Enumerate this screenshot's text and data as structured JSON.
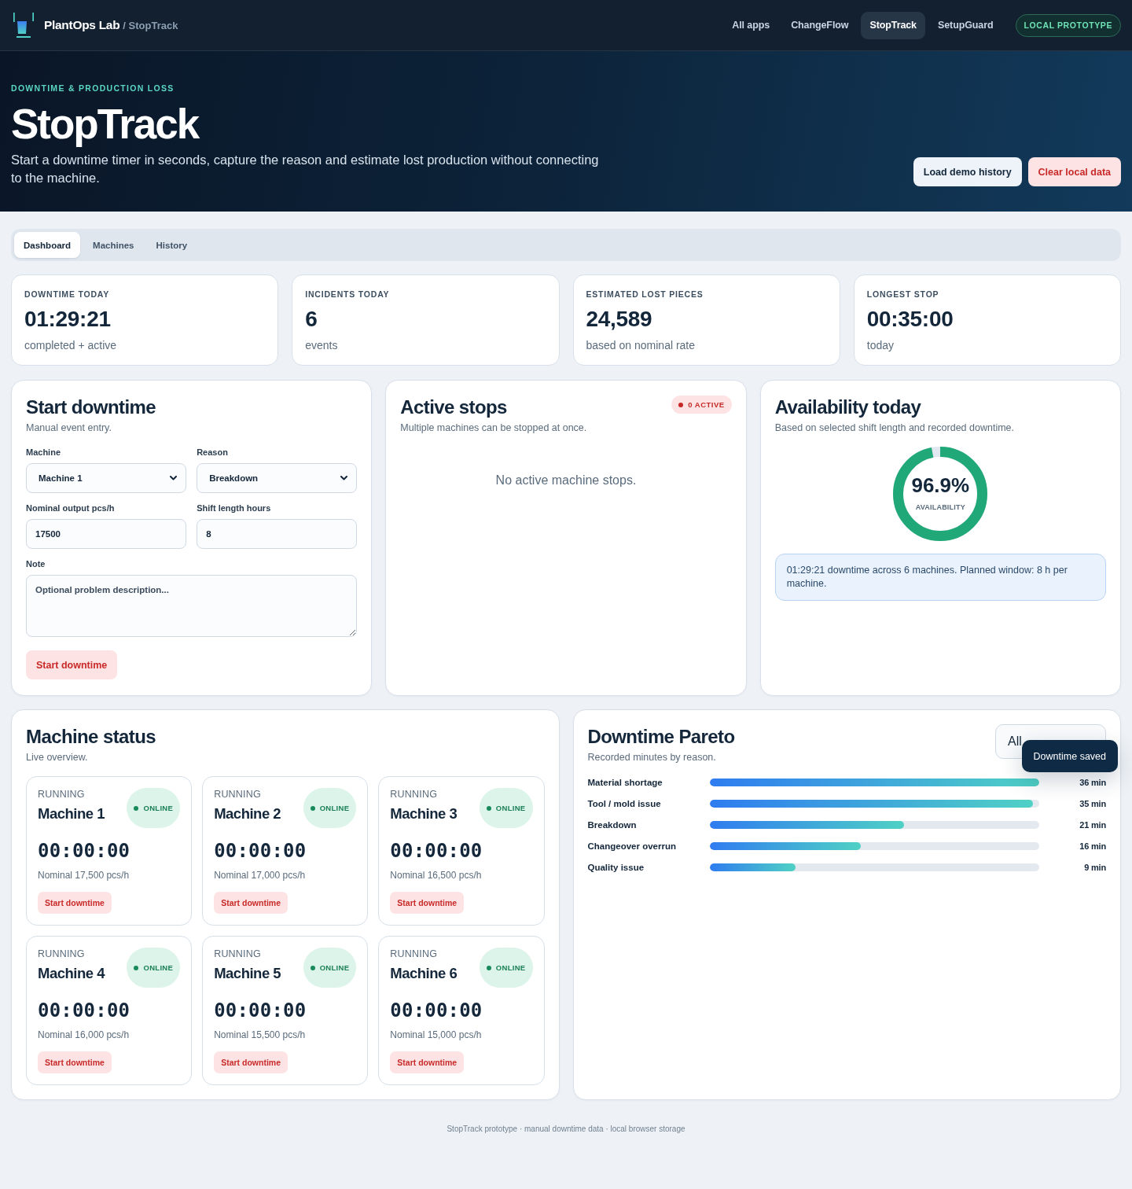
{
  "nav": {
    "brand": "PlantOps Lab",
    "product": "/ StopTrack",
    "links": [
      {
        "label": "All apps",
        "selected": false
      },
      {
        "label": "ChangeFlow",
        "selected": false
      },
      {
        "label": "StopTrack",
        "selected": true
      },
      {
        "label": "SetupGuard",
        "selected": false
      }
    ],
    "badge": "LOCAL PROTOTYPE"
  },
  "hero": {
    "eyebrow": "DOWNTIME & PRODUCTION LOSS",
    "title": "StopTrack",
    "description": "Start a downtime timer in seconds, capture the reason and estimate lost production without connecting to the machine.",
    "buttons": [
      {
        "label": "Load demo history",
        "kind": "secondary"
      },
      {
        "label": "Clear local data",
        "kind": "danger"
      }
    ]
  },
  "tabs": [
    {
      "label": "Dashboard",
      "selected": true
    },
    {
      "label": "Machines",
      "selected": false
    },
    {
      "label": "History",
      "selected": false
    }
  ],
  "stats": [
    {
      "label": "DOWNTIME TODAY",
      "value": "01:29:21",
      "caption": "completed + active"
    },
    {
      "label": "INCIDENTS TODAY",
      "value": "6",
      "caption": "events"
    },
    {
      "label": "ESTIMATED LOST PIECES",
      "value": "24,589",
      "caption": "based on nominal rate"
    },
    {
      "label": "LONGEST STOP",
      "value": "00:35:00",
      "caption": "today"
    }
  ],
  "start_form": {
    "title": "Start downtime",
    "subtitle": "Manual event entry.",
    "fields": [
      {
        "kind": "select",
        "label": "Machine",
        "value": "Machine 1"
      },
      {
        "kind": "select",
        "label": "Reason",
        "value": "Breakdown"
      },
      {
        "kind": "input",
        "label": "Nominal output pcs/h",
        "value": "17500"
      },
      {
        "kind": "input",
        "label": "Shift length hours",
        "value": "8"
      },
      {
        "kind": "textarea",
        "label": "Note",
        "placeholder": "Optional problem description..."
      }
    ],
    "button": "Start downtime"
  },
  "active_stops": {
    "title": "Active stops",
    "subtitle": "Multiple machines can be stopped at once.",
    "badge": "0 ACTIVE",
    "empty_message": "No active machine stops."
  },
  "availability": {
    "title": "Availability today",
    "subtitle": "Based on selected shift length and recorded downtime.",
    "level": 0.969,
    "reading": "96.9%",
    "caption": "AVAILABILITY",
    "note": "01:29:21 downtime across 6 machines. Planned window: 8 h per machine."
  },
  "machine_status": {
    "title": "Machine status",
    "subtitle": "Live overview.",
    "machines": [
      {
        "state": "RUNNING",
        "name": "Machine 1",
        "online": true,
        "status": "ONLINE",
        "timer": "00:00:00",
        "nominal": "Nominal 17,500 pcs/h",
        "button": "Start downtime"
      },
      {
        "state": "RUNNING",
        "name": "Machine 2",
        "online": true,
        "status": "ONLINE",
        "timer": "00:00:00",
        "nominal": "Nominal 17,000 pcs/h",
        "button": "Start downtime"
      },
      {
        "state": "RUNNING",
        "name": "Machine 3",
        "online": true,
        "status": "ONLINE",
        "timer": "00:00:00",
        "nominal": "Nominal 16,500 pcs/h",
        "button": "Start downtime"
      },
      {
        "state": "RUNNING",
        "name": "Machine 4",
        "online": true,
        "status": "ONLINE",
        "timer": "00:00:00",
        "nominal": "Nominal 16,000 pcs/h",
        "button": "Start downtime"
      },
      {
        "state": "RUNNING",
        "name": "Machine 5",
        "online": true,
        "status": "ONLINE",
        "timer": "00:00:00",
        "nominal": "Nominal 15,500 pcs/h",
        "button": "Start downtime"
      },
      {
        "state": "RUNNING",
        "name": "Machine 6",
        "online": true,
        "status": "ONLINE",
        "timer": "00:00:00",
        "nominal": "Nominal 15,000 pcs/h",
        "button": "Start downtime"
      }
    ]
  },
  "pareto": {
    "title": "Downtime Pareto",
    "subtitle": "Recorded minutes by reason.",
    "filter": "All",
    "rows": [
      {
        "reason": "Material shortage",
        "level": 1,
        "reading": "36 min"
      },
      {
        "reason": "Tool / mold issue",
        "level": 0.98,
        "reading": "35 min"
      },
      {
        "reason": "Breakdown",
        "level": 0.59,
        "reading": "21 min"
      },
      {
        "reason": "Changeover overrun",
        "level": 0.46,
        "reading": "16 min"
      },
      {
        "reason": "Quality issue",
        "level": 0.26,
        "reading": "9 min"
      }
    ]
  },
  "toast": "Downtime saved",
  "footer": "StopTrack prototype · manual downtime data · local browser storage"
}
